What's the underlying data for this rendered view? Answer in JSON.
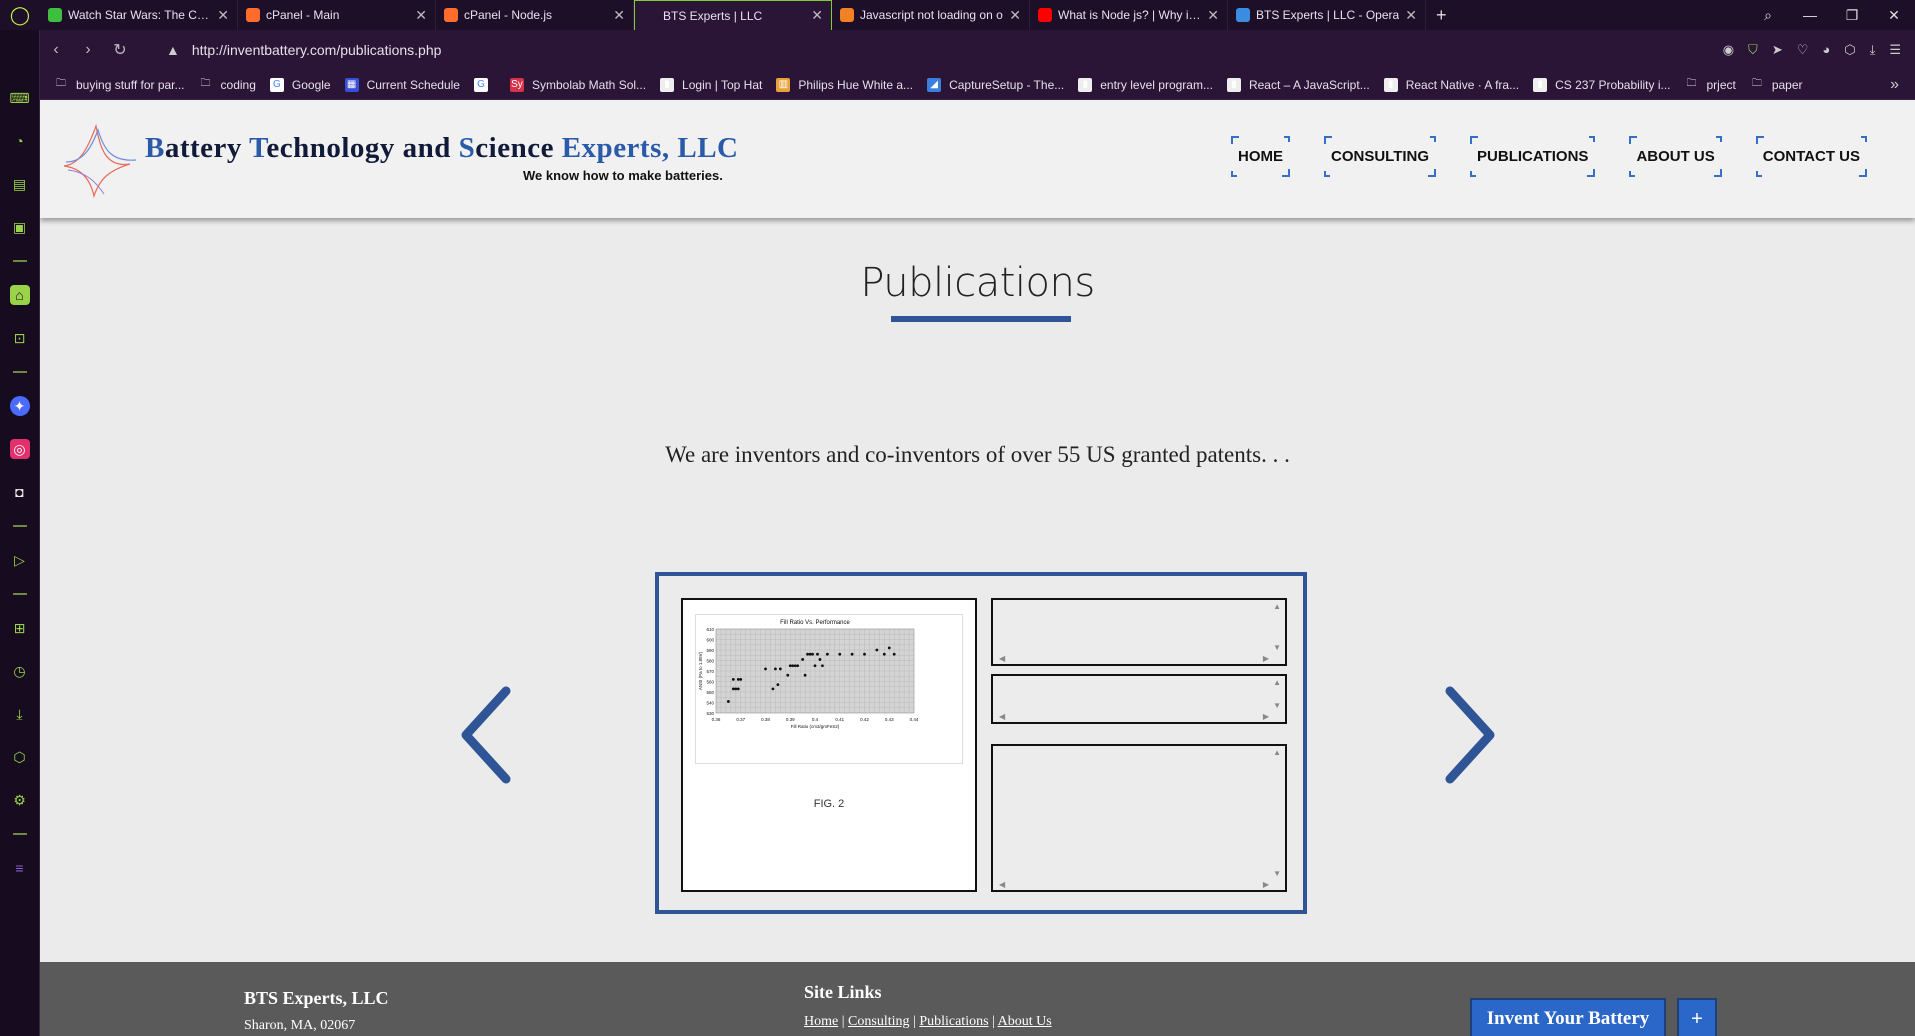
{
  "browser": {
    "tabs": [
      {
        "title": "Watch Star Wars: The Clone",
        "color": "#3fbf3f"
      },
      {
        "title": "cPanel - Main",
        "color": "#ff6c2c"
      },
      {
        "title": "cPanel - Node.js",
        "color": "#ff6c2c"
      },
      {
        "title": "BTS Experts | LLC",
        "color": "#2a1536",
        "active": true
      },
      {
        "title": "Javascript not loading on o",
        "color": "#f48024"
      },
      {
        "title": "What is Node js? | Why it is",
        "color": "#ff0000"
      },
      {
        "title": "BTS Experts | LLC - Opera",
        "color": "#3a8de0"
      }
    ],
    "url": "http://inventbattery.com/publications.php",
    "bookmarks": [
      {
        "label": "buying stuff for par...",
        "icon": "folder-icon"
      },
      {
        "label": "coding",
        "icon": "folder-icon"
      },
      {
        "label": "Google",
        "icon": "google-icon"
      },
      {
        "label": "Current Schedule",
        "icon": "schedule-icon"
      },
      {
        "label": "",
        "icon": "google-icon"
      },
      {
        "label": "Symbolab Math Sol...",
        "icon": "symbolab-icon"
      },
      {
        "label": "Login | Top Hat",
        "icon": "page-icon"
      },
      {
        "label": "Philips Hue White a...",
        "icon": "amazon-icon"
      },
      {
        "label": "CaptureSetup - The...",
        "icon": "capture-icon"
      },
      {
        "label": "entry level program...",
        "icon": "page-icon"
      },
      {
        "label": "React – A JavaScript...",
        "icon": "page-icon"
      },
      {
        "label": "React Native · A fra...",
        "icon": "page-icon"
      },
      {
        "label": "CS 237 Probability i...",
        "icon": "page-icon"
      },
      {
        "label": "prject",
        "icon": "folder-icon"
      },
      {
        "label": "paper",
        "icon": "folder-icon"
      }
    ]
  },
  "site": {
    "brand": {
      "w1": "B",
      "w1r": "attery ",
      "w2": "T",
      "w2r": "echnology and ",
      "w3": "S",
      "w3r": "cience ",
      "w4": "Experts, LLC"
    },
    "tagline": "We know how to make batteries.",
    "nav": [
      "HOME",
      "CONSULTING",
      "PUBLICATIONS",
      "ABOUT US",
      "CONTACT US"
    ],
    "page_title": "Publications",
    "intro": "We are inventors and co-inventors of over 55 US granted patents. . .",
    "figure": {
      "title": "Fill Ratio Vs. Performance",
      "ylabel": "ANSI (Pa to 1.85V)",
      "xlabel": "Fill Ratio (cm3/gmFeS2)",
      "caption": "FIG. 2",
      "x_ticks": [
        "0.36",
        "0.37",
        "0.38",
        "0.39",
        "0.4",
        "0.41",
        "0.42",
        "0.43",
        "0.44"
      ],
      "y_ticks": [
        "610",
        "600",
        "590",
        "580",
        "570",
        "560",
        "550",
        "540",
        "530"
      ]
    },
    "footer": {
      "company": "BTS Experts, LLC",
      "address": "Sharon, MA, 02067",
      "links_title": "Site Links",
      "links": [
        "Home",
        "Consulting",
        "Publications",
        "About Us"
      ],
      "cta": "Invent Your Battery",
      "plus": "+"
    }
  },
  "chart_data": {
    "type": "scatter",
    "title": "Fill Ratio Vs. Performance",
    "xlabel": "Fill Ratio (cm3/gmFeS2)",
    "ylabel": "ANSI (Pa to 1.85V)",
    "xlim": [
      0.36,
      0.44
    ],
    "ylim": [
      530,
      610
    ],
    "grid": true,
    "x": [
      0.365,
      0.367,
      0.368,
      0.369,
      0.367,
      0.369,
      0.37,
      0.38,
      0.383,
      0.384,
      0.385,
      0.386,
      0.389,
      0.39,
      0.391,
      0.392,
      0.393,
      0.395,
      0.396,
      0.397,
      0.398,
      0.399,
      0.4,
      0.401,
      0.402,
      0.403,
      0.405,
      0.41,
      0.415,
      0.42,
      0.425,
      0.428,
      0.43,
      0.432
    ],
    "y": [
      541,
      553,
      553,
      553,
      562,
      562,
      562,
      572,
      553,
      572,
      557,
      572,
      566,
      575,
      575,
      575,
      575,
      581,
      566,
      586,
      586,
      586,
      575,
      586,
      581,
      575,
      586,
      586,
      586,
      586,
      590,
      586,
      592,
      586
    ]
  }
}
